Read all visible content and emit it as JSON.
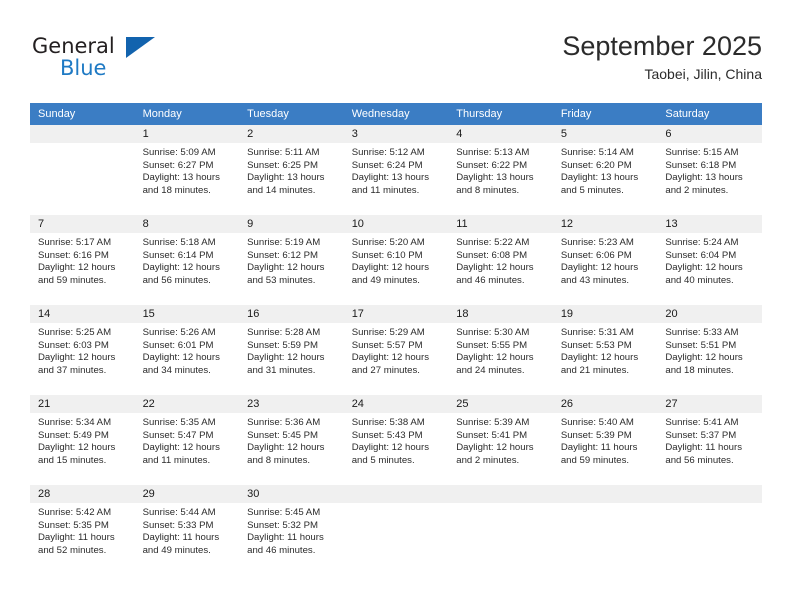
{
  "brand": {
    "name_part1": "General",
    "name_part2": "Blue",
    "triangle_icon": "triangle-icon",
    "colors": {
      "dark": "#231f20",
      "blue": "#1f7ac4",
      "triangle": "#1263ae"
    }
  },
  "header": {
    "month_title": "September 2025",
    "location": "Taobei, Jilin, China"
  },
  "calendar": {
    "header_color": "#3b7dc4",
    "weekdays": [
      "Sunday",
      "Monday",
      "Tuesday",
      "Wednesday",
      "Thursday",
      "Friday",
      "Saturday"
    ],
    "weeks": [
      [
        {
          "day": "",
          "lines": [
            "",
            "",
            "",
            ""
          ],
          "blank": true
        },
        {
          "day": "1",
          "lines": [
            "Sunrise: 5:09 AM",
            "Sunset: 6:27 PM",
            "Daylight: 13 hours",
            "and 18 minutes."
          ]
        },
        {
          "day": "2",
          "lines": [
            "Sunrise: 5:11 AM",
            "Sunset: 6:25 PM",
            "Daylight: 13 hours",
            "and 14 minutes."
          ]
        },
        {
          "day": "3",
          "lines": [
            "Sunrise: 5:12 AM",
            "Sunset: 6:24 PM",
            "Daylight: 13 hours",
            "and 11 minutes."
          ]
        },
        {
          "day": "4",
          "lines": [
            "Sunrise: 5:13 AM",
            "Sunset: 6:22 PM",
            "Daylight: 13 hours",
            "and 8 minutes."
          ]
        },
        {
          "day": "5",
          "lines": [
            "Sunrise: 5:14 AM",
            "Sunset: 6:20 PM",
            "Daylight: 13 hours",
            "and 5 minutes."
          ]
        },
        {
          "day": "6",
          "lines": [
            "Sunrise: 5:15 AM",
            "Sunset: 6:18 PM",
            "Daylight: 13 hours",
            "and 2 minutes."
          ]
        }
      ],
      [
        {
          "day": "7",
          "lines": [
            "Sunrise: 5:17 AM",
            "Sunset: 6:16 PM",
            "Daylight: 12 hours",
            "and 59 minutes."
          ]
        },
        {
          "day": "8",
          "lines": [
            "Sunrise: 5:18 AM",
            "Sunset: 6:14 PM",
            "Daylight: 12 hours",
            "and 56 minutes."
          ]
        },
        {
          "day": "9",
          "lines": [
            "Sunrise: 5:19 AM",
            "Sunset: 6:12 PM",
            "Daylight: 12 hours",
            "and 53 minutes."
          ]
        },
        {
          "day": "10",
          "lines": [
            "Sunrise: 5:20 AM",
            "Sunset: 6:10 PM",
            "Daylight: 12 hours",
            "and 49 minutes."
          ]
        },
        {
          "day": "11",
          "lines": [
            "Sunrise: 5:22 AM",
            "Sunset: 6:08 PM",
            "Daylight: 12 hours",
            "and 46 minutes."
          ]
        },
        {
          "day": "12",
          "lines": [
            "Sunrise: 5:23 AM",
            "Sunset: 6:06 PM",
            "Daylight: 12 hours",
            "and 43 minutes."
          ]
        },
        {
          "day": "13",
          "lines": [
            "Sunrise: 5:24 AM",
            "Sunset: 6:04 PM",
            "Daylight: 12 hours",
            "and 40 minutes."
          ]
        }
      ],
      [
        {
          "day": "14",
          "lines": [
            "Sunrise: 5:25 AM",
            "Sunset: 6:03 PM",
            "Daylight: 12 hours",
            "and 37 minutes."
          ]
        },
        {
          "day": "15",
          "lines": [
            "Sunrise: 5:26 AM",
            "Sunset: 6:01 PM",
            "Daylight: 12 hours",
            "and 34 minutes."
          ]
        },
        {
          "day": "16",
          "lines": [
            "Sunrise: 5:28 AM",
            "Sunset: 5:59 PM",
            "Daylight: 12 hours",
            "and 31 minutes."
          ]
        },
        {
          "day": "17",
          "lines": [
            "Sunrise: 5:29 AM",
            "Sunset: 5:57 PM",
            "Daylight: 12 hours",
            "and 27 minutes."
          ]
        },
        {
          "day": "18",
          "lines": [
            "Sunrise: 5:30 AM",
            "Sunset: 5:55 PM",
            "Daylight: 12 hours",
            "and 24 minutes."
          ]
        },
        {
          "day": "19",
          "lines": [
            "Sunrise: 5:31 AM",
            "Sunset: 5:53 PM",
            "Daylight: 12 hours",
            "and 21 minutes."
          ]
        },
        {
          "day": "20",
          "lines": [
            "Sunrise: 5:33 AM",
            "Sunset: 5:51 PM",
            "Daylight: 12 hours",
            "and 18 minutes."
          ]
        }
      ],
      [
        {
          "day": "21",
          "lines": [
            "Sunrise: 5:34 AM",
            "Sunset: 5:49 PM",
            "Daylight: 12 hours",
            "and 15 minutes."
          ]
        },
        {
          "day": "22",
          "lines": [
            "Sunrise: 5:35 AM",
            "Sunset: 5:47 PM",
            "Daylight: 12 hours",
            "and 11 minutes."
          ]
        },
        {
          "day": "23",
          "lines": [
            "Sunrise: 5:36 AM",
            "Sunset: 5:45 PM",
            "Daylight: 12 hours",
            "and 8 minutes."
          ]
        },
        {
          "day": "24",
          "lines": [
            "Sunrise: 5:38 AM",
            "Sunset: 5:43 PM",
            "Daylight: 12 hours",
            "and 5 minutes."
          ]
        },
        {
          "day": "25",
          "lines": [
            "Sunrise: 5:39 AM",
            "Sunset: 5:41 PM",
            "Daylight: 12 hours",
            "and 2 minutes."
          ]
        },
        {
          "day": "26",
          "lines": [
            "Sunrise: 5:40 AM",
            "Sunset: 5:39 PM",
            "Daylight: 11 hours",
            "and 59 minutes."
          ]
        },
        {
          "day": "27",
          "lines": [
            "Sunrise: 5:41 AM",
            "Sunset: 5:37 PM",
            "Daylight: 11 hours",
            "and 56 minutes."
          ]
        }
      ],
      [
        {
          "day": "28",
          "lines": [
            "Sunrise: 5:42 AM",
            "Sunset: 5:35 PM",
            "Daylight: 11 hours",
            "and 52 minutes."
          ]
        },
        {
          "day": "29",
          "lines": [
            "Sunrise: 5:44 AM",
            "Sunset: 5:33 PM",
            "Daylight: 11 hours",
            "and 49 minutes."
          ]
        },
        {
          "day": "30",
          "lines": [
            "Sunrise: 5:45 AM",
            "Sunset: 5:32 PM",
            "Daylight: 11 hours",
            "and 46 minutes."
          ]
        },
        {
          "day": "",
          "lines": [
            "",
            "",
            "",
            ""
          ],
          "blank": true
        },
        {
          "day": "",
          "lines": [
            "",
            "",
            "",
            ""
          ],
          "blank": true
        },
        {
          "day": "",
          "lines": [
            "",
            "",
            "",
            ""
          ],
          "blank": true
        },
        {
          "day": "",
          "lines": [
            "",
            "",
            "",
            ""
          ],
          "blank": true
        }
      ]
    ]
  }
}
